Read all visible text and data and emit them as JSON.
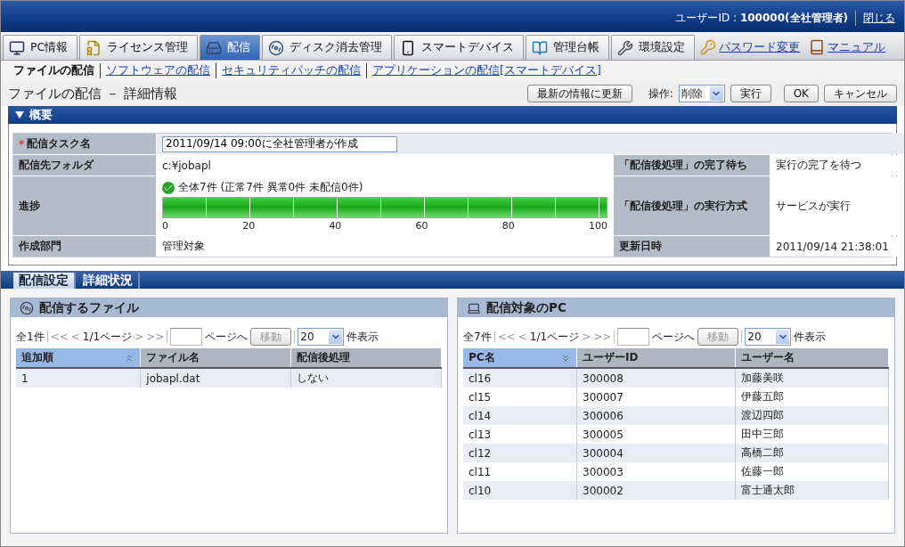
{
  "header": {
    "user_label": "ユーザーID : ",
    "user_value": "100000(全社管理者)",
    "close_link": "閉じる"
  },
  "nav": [
    {
      "label": "PC情報",
      "kind": "tab",
      "selected": false
    },
    {
      "label": "ライセンス管理",
      "kind": "tab",
      "selected": false
    },
    {
      "label": "配信",
      "kind": "tab",
      "selected": true
    },
    {
      "label": "ディスク消去管理",
      "kind": "tab",
      "selected": false
    },
    {
      "label": "スマートデバイス",
      "kind": "tab",
      "selected": false
    },
    {
      "label": "管理台帳",
      "kind": "tab",
      "selected": false
    },
    {
      "label": "環境設定",
      "kind": "tab",
      "selected": false
    },
    {
      "label": "パスワード変更",
      "kind": "link",
      "selected": false
    },
    {
      "label": "マニュアル",
      "kind": "link",
      "selected": false
    }
  ],
  "subnav": [
    {
      "label": "ファイルの配信",
      "selected": true
    },
    {
      "label": "ソフトウェアの配信",
      "selected": false
    },
    {
      "label": "セキュリティパッチの配信",
      "selected": false
    },
    {
      "label": "アプリケーションの配信[スマートデバイス]",
      "selected": false
    }
  ],
  "page_title": "ファイルの配信 － 詳細情報",
  "toolbar": {
    "refresh": "最新の情報に更新",
    "operation_label": "操作:",
    "operation_value": "削除",
    "run": "実行",
    "ok": "OK",
    "cancel": "キャンセル"
  },
  "overview": {
    "title": "概要",
    "expanded": true,
    "rows": [
      {
        "label": "配信タスク名",
        "marker": "*",
        "kind": "input",
        "value": "2011/09/14 09:00に全社管理者が作成"
      },
      {
        "label": "配信先フォルダ",
        "kind": "text",
        "value": "c:¥jobapl",
        "right_label": "「配信後処理」の完了待ち",
        "right_value": "実行の完了を待つ"
      },
      {
        "label": "進捗",
        "kind": "progress",
        "value": "全体7件 (正常7件 異常0件 未配信0件)",
        "level": 1,
        "scale": [
          "0",
          "20",
          "40",
          "60",
          "80",
          "100"
        ],
        "right_label": "「配信後処理」の実行方式",
        "right_value": "サービスが実行"
      },
      {
        "label": "作成部門",
        "kind": "text",
        "value": "管理対象",
        "right_label": "更新日時",
        "right_value": "2011/09/14 21:38:01"
      }
    ]
  },
  "detail_tabs": [
    {
      "label": "配信設定",
      "selected": true
    },
    {
      "label": "詳細状況",
      "selected": false
    }
  ],
  "panels": [
    {
      "title": "配信するファイル",
      "pager": {
        "total": "全1件",
        "first": "<<",
        "prev": "<",
        "page": "1/1ページ",
        "next": ">",
        "last": ">>",
        "goto": "ページへ",
        "move": "移動",
        "per_page": "20",
        "per_page_label": "件表示"
      },
      "columns": [
        {
          "label": "追加順",
          "sorted": true
        },
        {
          "label": "ファイル名",
          "sorted": false
        },
        {
          "label": "配信後処理",
          "sorted": false
        }
      ],
      "rows": [
        [
          "1",
          "jobapl.dat",
          "しない"
        ]
      ]
    },
    {
      "title": "配信対象のPC",
      "pager": {
        "total": "全7件",
        "first": "<<",
        "prev": "<",
        "page": "1/1ページ",
        "next": ">",
        "last": ">>",
        "goto": "ページへ",
        "move": "移動",
        "per_page": "20",
        "per_page_label": "件表示"
      },
      "columns": [
        {
          "label": "PC名",
          "sorted": true
        },
        {
          "label": "ユーザーID",
          "sorted": false
        },
        {
          "label": "ユーザー名",
          "sorted": false
        }
      ],
      "rows": [
        [
          "cl16",
          "300008",
          "加藤美咲"
        ],
        [
          "cl15",
          "300007",
          "伊藤五郎"
        ],
        [
          "cl14",
          "300006",
          "渡辺四郎"
        ],
        [
          "cl13",
          "300005",
          "田中三郎"
        ],
        [
          "cl12",
          "300004",
          "高橋二郎"
        ],
        [
          "cl11",
          "300003",
          "佐藤一郎"
        ],
        [
          "cl10",
          "300002",
          "富士通太郎"
        ]
      ]
    }
  ]
}
